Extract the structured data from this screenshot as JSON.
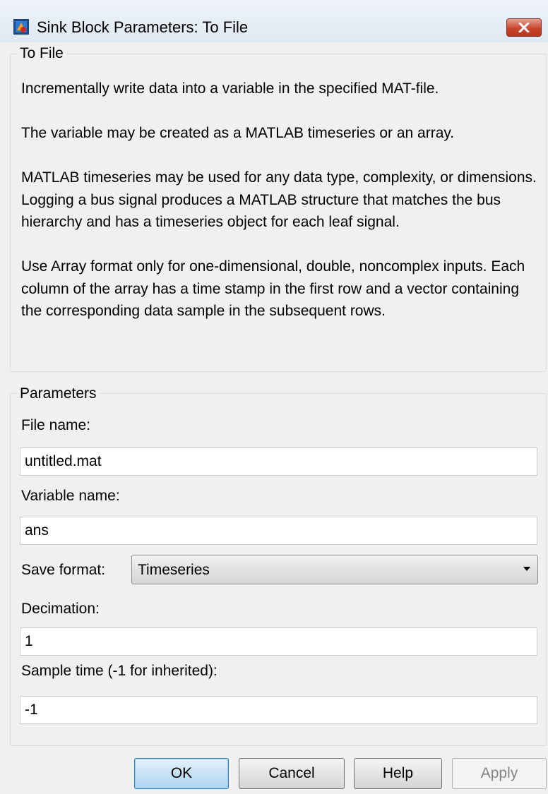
{
  "window": {
    "title": "Sink Block Parameters: To File"
  },
  "description": {
    "group_label": "To File",
    "paragraphs": [
      "Incrementally write data into a variable in the specified MAT-file.",
      "The variable may be created as a MATLAB timeseries or an array.",
      "MATLAB timeseries may be used for any data type, complexity, or dimensions. Logging a bus signal produces a MATLAB structure that matches the bus hierarchy and has a timeseries object for each leaf signal.",
      "Use Array format only for one-dimensional, double, noncomplex inputs. Each column of the array has a time stamp in the first row and a vector containing the corresponding data sample in the subsequent rows."
    ]
  },
  "parameters": {
    "group_label": "Parameters",
    "file_name": {
      "label": "File name:",
      "value": "untitled.mat"
    },
    "variable_name": {
      "label": "Variable name:",
      "value": "ans"
    },
    "save_format": {
      "label": "Save format:",
      "value": "Timeseries"
    },
    "decimation": {
      "label": "Decimation:",
      "value": "1"
    },
    "sample_time": {
      "label": "Sample time (-1 for inherited):",
      "value": "-1"
    }
  },
  "buttons": {
    "ok": "OK",
    "cancel": "Cancel",
    "help": "Help",
    "apply": "Apply"
  },
  "icons": {
    "app": "simulink-block-icon",
    "close": "close-icon"
  },
  "colors": {
    "close_button": "#c8452e",
    "default_button_border": "#3c7fb1",
    "disabled_text": "#838383"
  }
}
